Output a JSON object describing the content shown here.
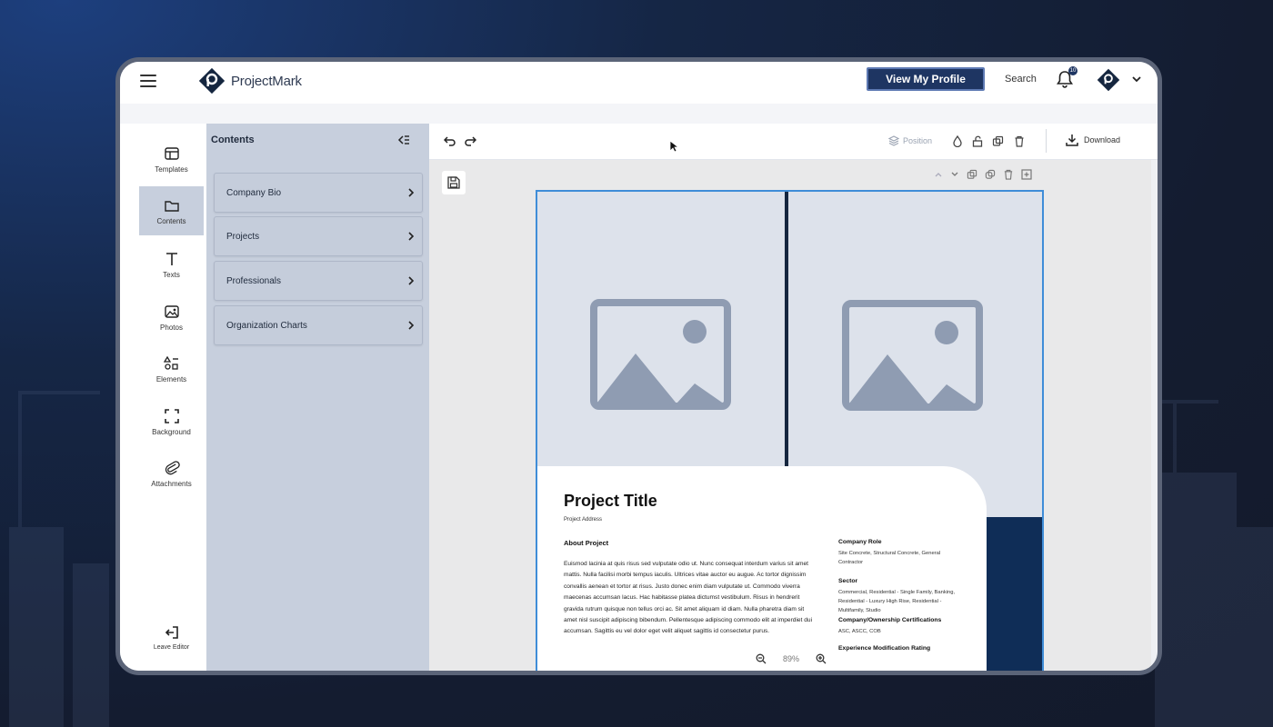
{
  "app": {
    "name": "ProjectMark"
  },
  "header": {
    "view_profile_label": "View My Profile",
    "search_label": "Search",
    "notification_count": "10"
  },
  "rail": {
    "items": [
      {
        "label": "Templates",
        "icon": "template-icon"
      },
      {
        "label": "Contents",
        "icon": "folder-icon",
        "active": true
      },
      {
        "label": "Texts",
        "icon": "text-icon"
      },
      {
        "label": "Photos",
        "icon": "photo-icon"
      },
      {
        "label": "Elements",
        "icon": "elements-icon"
      },
      {
        "label": "Background",
        "icon": "background-icon"
      },
      {
        "label": "Attachments",
        "icon": "paperclip-icon"
      }
    ],
    "leave_label": "Leave Editor"
  },
  "panel": {
    "title": "Contents",
    "items": [
      {
        "label": "Company Bio"
      },
      {
        "label": "Projects"
      },
      {
        "label": "Professionals"
      },
      {
        "label": "Organization Charts"
      }
    ]
  },
  "toolbar": {
    "position_label": "Position",
    "download_label": "Download"
  },
  "document": {
    "title": "Project Title",
    "address": "Project Address",
    "about_heading": "About Project",
    "about_text": "Euismod lacinia at quis risus sed vulputate odio ut. Nunc consequat interdum varius sit amet mattis. Nulla facilisi morbi tempus iaculis. Ultrices vitae auctor eu augue. Ac tortor dignissim convallis aenean et tortor at risus. Justo donec enim diam vulputate ut. Commodo viverra maecenas accumsan lacus. Hac habitasse platea dictumst vestibulum. Risus in hendrerit gravida rutrum quisque non tellus orci ac. Sit amet aliquam id diam. Nulla pharetra diam sit amet nisl suscipit adipiscing bibendum. Pellentesque adipiscing commodo elit at imperdiet dui accumsan. Sagittis eu vel dolor eget velit aliquet sagittis id consectetur purus.",
    "side": [
      {
        "heading": "Company Role",
        "value": "Site Concrete, Structural Concrete, General Contractor"
      },
      {
        "heading": "Sector",
        "value": "Commercial, Residential - Single Family, Banking, Residential - Luxury High Rise, Residential - Multifamily, Studio"
      },
      {
        "heading": "Company/Ownership Certifications",
        "value": "ASC, ASCC, COB"
      },
      {
        "heading": "Experience Modification Rating",
        "value": ""
      }
    ],
    "zoom_level": "89%"
  }
}
